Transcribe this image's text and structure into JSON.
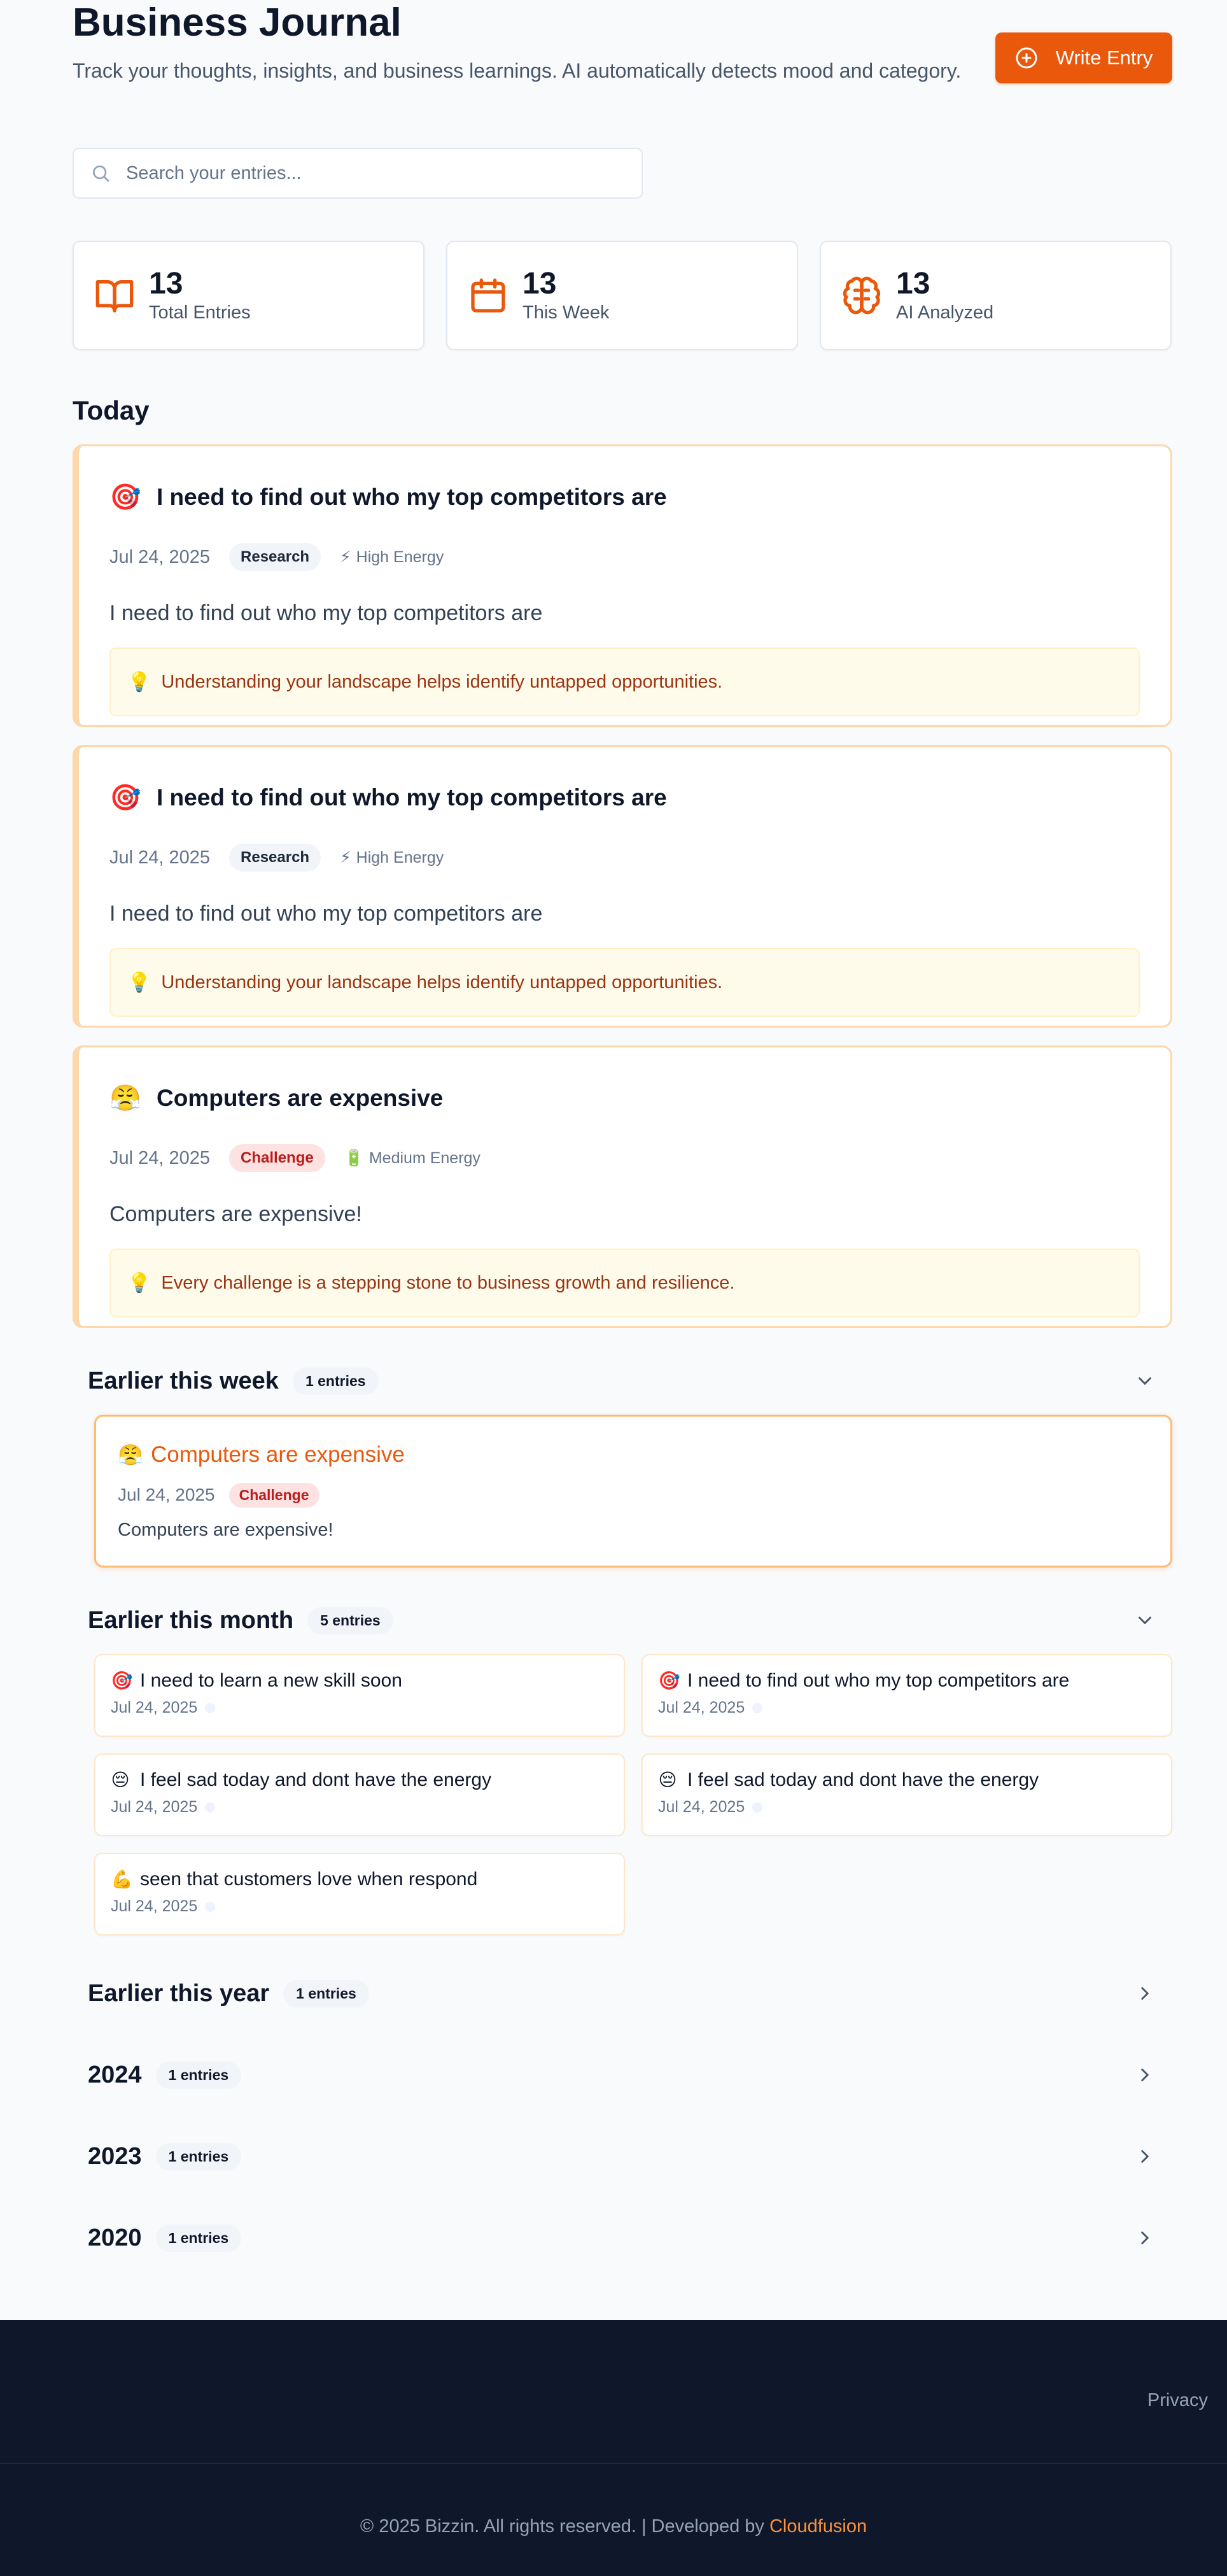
{
  "header": {
    "title": "Business Journal",
    "subtitle": "Track your thoughts, insights, and business learnings. AI automatically detects mood and category.",
    "write_button": "Write Entry"
  },
  "search": {
    "placeholder": "Search your entries..."
  },
  "stats": [
    {
      "icon": "book-open-icon",
      "value": "13",
      "label": "Total Entries"
    },
    {
      "icon": "calendar-icon",
      "value": "13",
      "label": "This Week"
    },
    {
      "icon": "brain-icon",
      "value": "13",
      "label": "AI Analyzed"
    }
  ],
  "today": {
    "title": "Today",
    "entries": [
      {
        "emoji": "🎯",
        "title": "I need to find out who my top competitors are",
        "date": "Jul 24, 2025",
        "category": "Research",
        "energy_icon": "⚡",
        "energy": "High Energy",
        "body": "I need to find out who my top competitors are",
        "insight_icon": "💡",
        "insight": "Understanding your landscape helps identify untapped opportunities."
      },
      {
        "emoji": "🎯",
        "title": "I need to find out who my top competitors are",
        "date": "Jul 24, 2025",
        "category": "Research",
        "energy_icon": "⚡",
        "energy": "High Energy",
        "body": "I need to find out who my top competitors are",
        "insight_icon": "💡",
        "insight": "Understanding your landscape helps identify untapped opportunities."
      },
      {
        "emoji": "😤",
        "title": "Computers are expensive",
        "date": "Jul 24, 2025",
        "category": "Challenge",
        "energy_icon": "🔋",
        "energy": "Medium Energy",
        "body": "Computers are expensive!",
        "insight_icon": "💡",
        "insight": "Every challenge is a stepping stone to business growth and resilience."
      }
    ]
  },
  "earlier_week": {
    "title": "Earlier this week",
    "count": "1 entries",
    "entry": {
      "emoji": "😤",
      "title": "Computers are expensive",
      "date": "Jul 24, 2025",
      "category": "Challenge",
      "body": "Computers are expensive!"
    }
  },
  "earlier_month": {
    "title": "Earlier this month",
    "count": "5 entries",
    "entries": [
      {
        "emoji": "🎯",
        "title": "I need to learn a new skill soon",
        "date": "Jul 24, 2025"
      },
      {
        "emoji": "🎯",
        "title": "I need to find out who my top competitors are",
        "date": "Jul 24, 2025"
      },
      {
        "emoji": "😔",
        "title": "I feel sad today and dont have the energy",
        "date": "Jul 24, 2025"
      },
      {
        "emoji": "😔",
        "title": "I feel sad today and dont have the energy",
        "date": "Jul 24, 2025"
      },
      {
        "emoji": "💪",
        "title": "seen that customers love when respond",
        "date": "Jul 24, 2025"
      }
    ]
  },
  "collapsed_groups": [
    {
      "title": "Earlier this year",
      "count": "1 entries"
    },
    {
      "title": "2024",
      "count": "1 entries"
    },
    {
      "title": "2023",
      "count": "1 entries"
    },
    {
      "title": "2020",
      "count": "1 entries"
    }
  ],
  "footer": {
    "privacy": "Privacy",
    "copyright": "© 2025 Bizzin. All rights reserved. | Developed by ",
    "brand": "Cloudfusion"
  },
  "colors": {
    "accent": "#ea580c",
    "footer_bg": "#0f172a"
  }
}
